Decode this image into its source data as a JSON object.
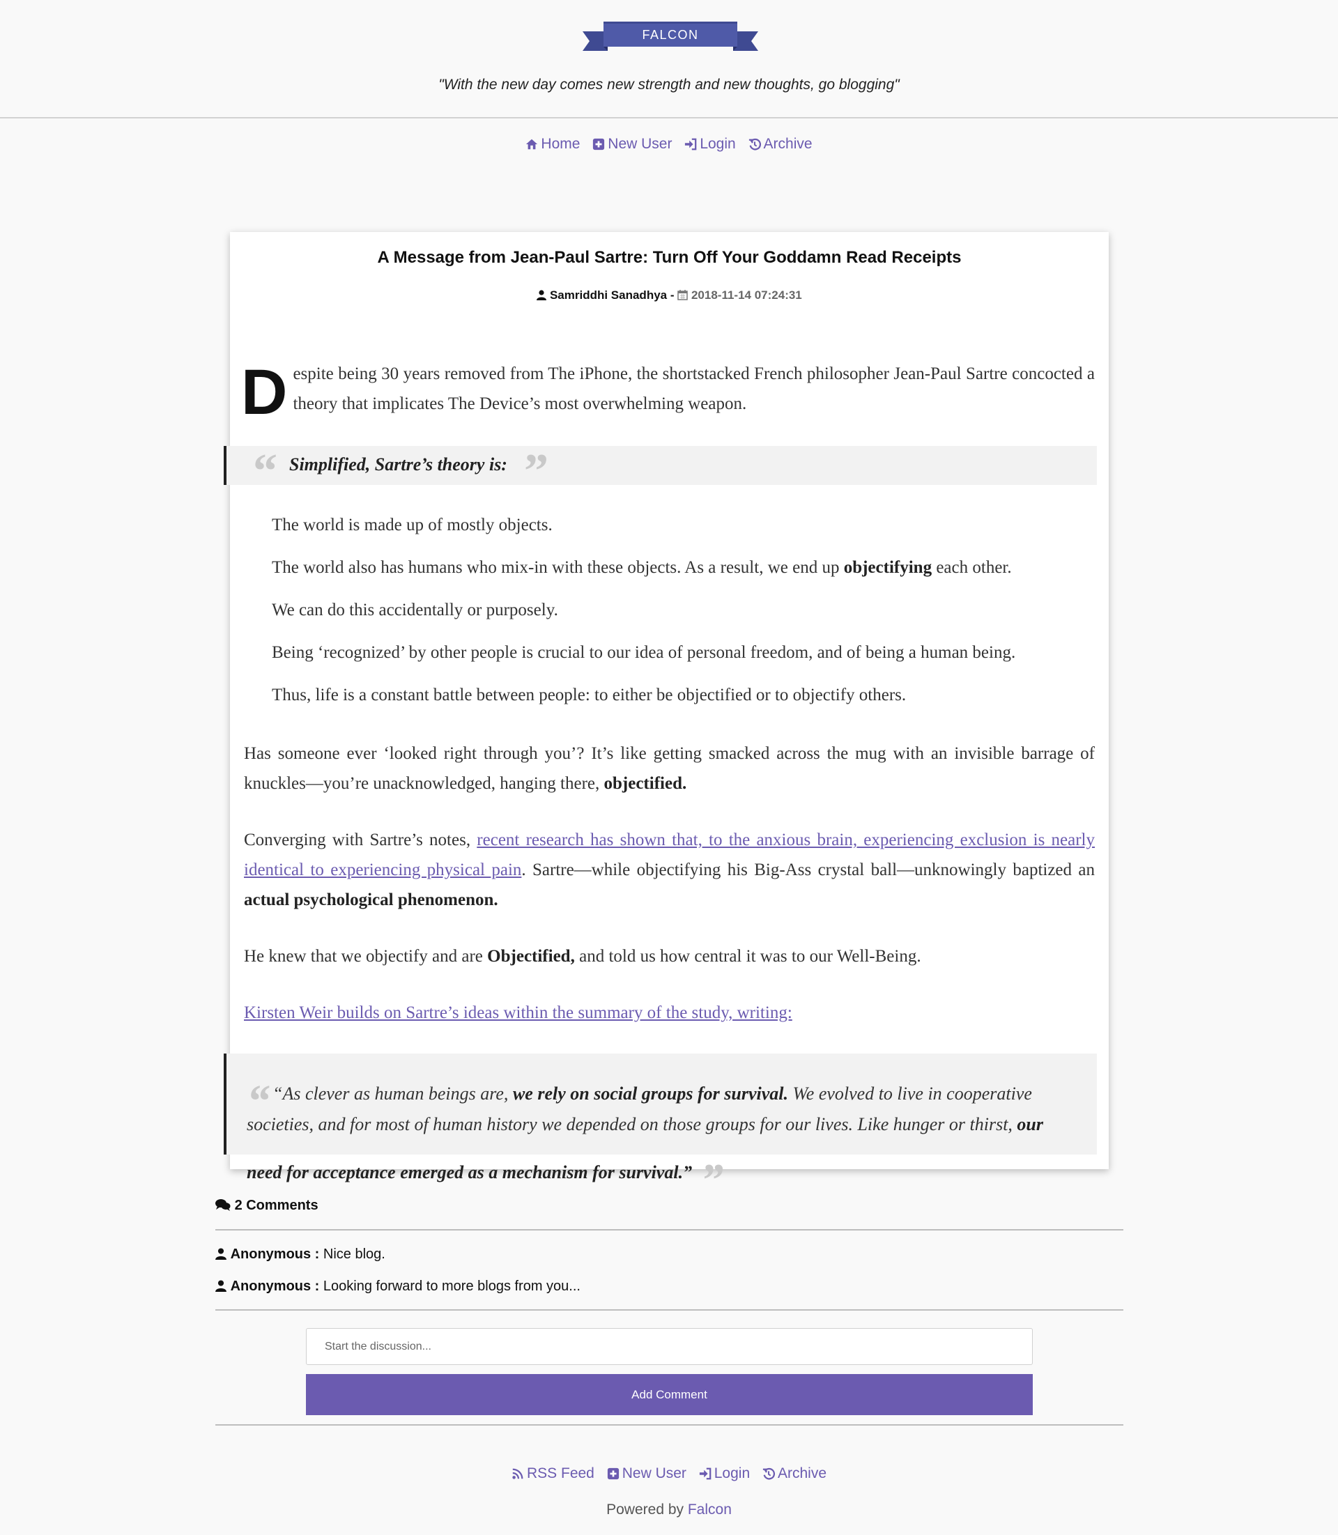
{
  "brand": {
    "logo_text": "FALCON",
    "tagline": "\"With the new day comes new strength and new thoughts, go blogging\""
  },
  "colors": {
    "accent": "#6b5bb0",
    "logo_blue": "#3f4a92",
    "background": "#f9f9f9",
    "quote_bg": "#f2f2f2"
  },
  "nav": {
    "items": [
      {
        "label": "Home",
        "icon": "home-icon"
      },
      {
        "label": "New User",
        "icon": "plus-square-icon"
      },
      {
        "label": "Login",
        "icon": "sign-in-icon"
      },
      {
        "label": "Archive",
        "icon": "history-icon"
      }
    ]
  },
  "post": {
    "title": "A Message from Jean-Paul Sartre: Turn Off Your Goddamn Read Receipts",
    "author": "Samriddhi Sanadhya -",
    "date": "2018-11-14 07:24:31",
    "dropcap": "D",
    "intro": "espite being 30 years removed from The iPhone, the shortstacked French philosopher Jean-Paul Sartre concocted a theory that implicates The Device’s most overwhelming weapon.",
    "quote1": "Simplified, Sartre’s theory is:",
    "list": {
      "item1": "The world is made up of mostly objects.",
      "item2_pre": "The world also has humans who mix-in with these objects. As a result, we end up ",
      "item2_bold": "objectifying",
      "item2_post": " each other.",
      "item3": "We can do this accidentally or purposely.",
      "item4": "Being ‘recognized’ by other people is crucial to our idea of personal freedom, and of being a human being.",
      "item5": "Thus, life is a constant battle between people: to either be objectified or to objectify others."
    },
    "para2_pre": "Has someone ever ‘looked right through you’? It’s like getting smacked across the mug with an invisible barrage of knuckles—you’re unacknowledged, hanging there, ",
    "para2_bold": "objectified.",
    "para3_pre": "Converging with Sartre’s notes, ",
    "para3_link": "recent research has shown that, to the anxious brain, experiencing exclusion is nearly identical to experiencing physical pain",
    "para3_mid": ". Sartre—while objectifying his Big-Ass crystal ball—unknowingly baptized an ",
    "para3_bold": "actual psychological phenomenon.",
    "para4_pre": "He knew that we objectify and are ",
    "para4_bold": "Objectified,",
    "para4_post": " and told us how central it was to our Well-Being.",
    "para5_link": "Kirsten Weir builds on Sartre’s ideas within the summary of the study, writing:",
    "quote2": {
      "a": "“As clever as human beings are, ",
      "b": "we rely on social groups for survival.",
      "c": " We evolved to live in cooperative societies, and for most of human history we depended on those groups for our lives. Like hunger or thirst, ",
      "d": "our need for acceptance emerged as a mechanism for survival.”"
    }
  },
  "comments": {
    "heading": "2 Comments",
    "items": [
      {
        "author": "Anonymous :",
        "text": "Nice blog."
      },
      {
        "author": "Anonymous :",
        "text": "Looking forward to more blogs from you..."
      }
    ],
    "input_placeholder": "Start the discussion...",
    "button_label": "Add Comment"
  },
  "footer": {
    "nav": [
      {
        "label": "RSS Feed",
        "icon": "rss-icon"
      },
      {
        "label": "New User",
        "icon": "plus-square-icon"
      },
      {
        "label": "Login",
        "icon": "sign-in-icon"
      },
      {
        "label": "Archive",
        "icon": "history-icon"
      }
    ],
    "powered_prefix": "Powered by",
    "powered_link": "Falcon"
  }
}
